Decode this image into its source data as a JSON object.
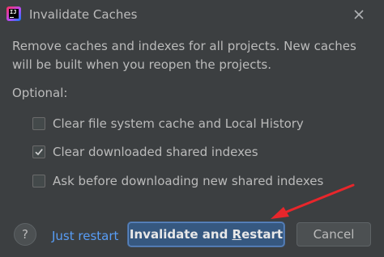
{
  "window": {
    "title": "Invalidate Caches",
    "app_icon": "intellij-idea-icon",
    "close_icon": "close-icon"
  },
  "dialog": {
    "description": "Remove caches and indexes for all projects. New caches will be built when you reopen the projects.",
    "optional_label": "Optional:",
    "options": [
      {
        "label": "Clear file system cache and Local History",
        "checked": false
      },
      {
        "label": "Clear downloaded shared indexes",
        "checked": true
      },
      {
        "label": "Ask before downloading new shared indexes",
        "checked": false
      }
    ]
  },
  "footer": {
    "help_label": "?",
    "just_restart_label": "Just restart",
    "primary_label": "Invalidate and Restart",
    "primary_mnemonic_char": "R",
    "cancel_label": "Cancel"
  },
  "colors": {
    "background": "#3c3f41",
    "text": "#bbbbbb",
    "link": "#589df6",
    "primary_button": "#365880",
    "annotation_arrow": "#e8262b"
  }
}
